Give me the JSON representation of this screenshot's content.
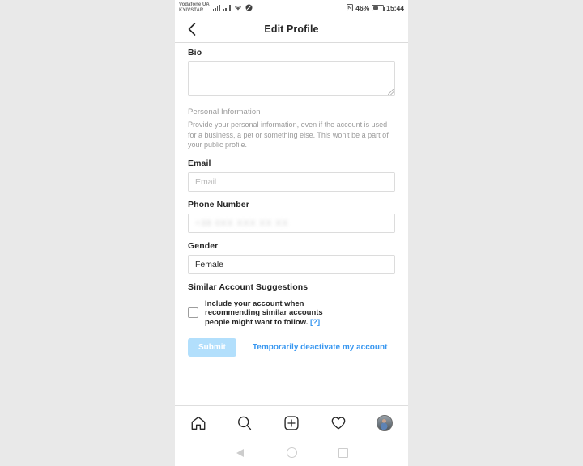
{
  "status_bar": {
    "carrier_primary": "Vodafone UA",
    "carrier_secondary": "KYIVSTAR",
    "battery_percent": "46%",
    "time": "15:44",
    "icons": [
      "signal-bars-icon",
      "signal-bars-icon",
      "wifi-icon",
      "mute-icon",
      "nfc-icon",
      "battery-icon"
    ]
  },
  "header": {
    "title": "Edit Profile",
    "back_icon": "chevron-left-icon"
  },
  "form": {
    "bio": {
      "label": "Bio",
      "value": "",
      "placeholder": ""
    },
    "personal_information": {
      "title": "Personal Information",
      "description": "Provide your personal information, even if the account is used for a business, a pet or something else. This won't be a part of your public profile."
    },
    "email": {
      "label": "Email",
      "value": "",
      "placeholder": "Email"
    },
    "phone_number": {
      "label": "Phone Number",
      "value": "redacted",
      "placeholder": ""
    },
    "gender": {
      "label": "Gender",
      "value": "Female",
      "placeholder": ""
    },
    "similar_accounts": {
      "title": "Similar Account Suggestions",
      "checkbox_checked": false,
      "checkbox_label": "Include your account when recommending similar accounts people might want to follow.",
      "help_label": "[?]"
    },
    "actions": {
      "submit_label": "Submit",
      "submit_disabled": true,
      "deactivate_label": "Temporarily deactivate my account"
    }
  },
  "tab_bar": {
    "items": [
      {
        "name": "home-icon",
        "label": "Home"
      },
      {
        "name": "search-icon",
        "label": "Search"
      },
      {
        "name": "add-post-icon",
        "label": "Add"
      },
      {
        "name": "heart-icon",
        "label": "Activity"
      },
      {
        "name": "profile-avatar",
        "label": "Profile"
      }
    ]
  },
  "system_nav": {
    "back": "back-triangle-icon",
    "home": "home-circle-icon",
    "recents": "recents-square-icon"
  },
  "colors": {
    "accent_blue": "#3897f0",
    "submit_disabled": "#b2dffc",
    "text_primary": "#262626",
    "text_muted": "#9a9a9a",
    "border": "#dcdcdc",
    "page_background": "#e9e9e9"
  }
}
